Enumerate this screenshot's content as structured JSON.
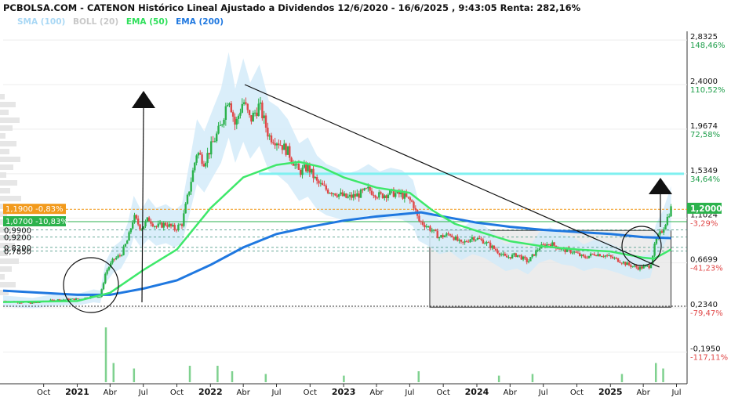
{
  "title": "PCBOLSA.COM - CATENON Histórico Lineal Ajustado a Dividendos 12/6/2020 - 16/6/2025 , 9:43:05 Renta: 282,16%",
  "legend": [
    {
      "label": "SMA (100)",
      "color": "#a9d8f5"
    },
    {
      "label": "BOLL (20)",
      "color": "#c8c8c8"
    },
    {
      "label": "EMA (50)",
      "color": "#2ee05a"
    },
    {
      "label": "EMA (200)",
      "color": "#1f78e0"
    }
  ],
  "colors": {
    "up": "#2bb24c",
    "down": "#e04848",
    "ema50": "#3ee86a",
    "ema200": "#1f78e0",
    "resistance": "#7ff0f0",
    "boll_fill": "#d4ebf9"
  },
  "chart_data": {
    "type": "candlestick",
    "x_ticks": [
      {
        "date": "2020-10-01",
        "label": "Oct",
        "bold": false
      },
      {
        "date": "2021-01-01",
        "label": "2021",
        "bold": true
      },
      {
        "date": "2021-04-01",
        "label": "Abr",
        "bold": false
      },
      {
        "date": "2021-07-01",
        "label": "Jul",
        "bold": false
      },
      {
        "date": "2021-10-01",
        "label": "Oct",
        "bold": false
      },
      {
        "date": "2022-01-01",
        "label": "2022",
        "bold": true
      },
      {
        "date": "2022-04-01",
        "label": "Abr",
        "bold": false
      },
      {
        "date": "2022-07-01",
        "label": "Jul",
        "bold": false
      },
      {
        "date": "2022-10-01",
        "label": "Oct",
        "bold": false
      },
      {
        "date": "2023-01-01",
        "label": "2023",
        "bold": true
      },
      {
        "date": "2023-04-01",
        "label": "Abr",
        "bold": false
      },
      {
        "date": "2023-07-01",
        "label": "Jul",
        "bold": false
      },
      {
        "date": "2023-10-01",
        "label": "Oct",
        "bold": false
      },
      {
        "date": "2024-01-01",
        "label": "2024",
        "bold": true
      },
      {
        "date": "2024-04-01",
        "label": "Abr",
        "bold": false
      },
      {
        "date": "2024-07-01",
        "label": "Jul",
        "bold": false
      },
      {
        "date": "2024-10-01",
        "label": "Oct",
        "bold": false
      },
      {
        "date": "2025-01-01",
        "label": "2025",
        "bold": true
      },
      {
        "date": "2025-04-01",
        "label": "Abr",
        "bold": false
      },
      {
        "date": "2025-07-01",
        "label": "Jul",
        "bold": false
      }
    ],
    "y_ticks": [
      {
        "value": 2.8325,
        "price": "2,8325",
        "pct": "148,46%"
      },
      {
        "value": 2.4,
        "price": "2,4000",
        "pct": "110,52%"
      },
      {
        "value": 1.9674,
        "price": "1,9674",
        "pct": "72,58%"
      },
      {
        "value": 1.5349,
        "price": "1,5349",
        "pct": "34,64%"
      },
      {
        "value": 1.1024,
        "price": "1,1024",
        "pct": "-3,29%"
      },
      {
        "value": 0.6699,
        "price": "0,6699",
        "pct": "-41,23%"
      },
      {
        "value": 0.234,
        "price": "0,2340",
        "pct": "-79,47%"
      },
      {
        "value": -0.195,
        "price": "-0,1950",
        "pct": "-117,11%"
      }
    ],
    "current_price": "1,2000",
    "left_tags": [
      {
        "text": "1,1900 -0,83%",
        "value": 1.19,
        "bg": "#f29a1c",
        "color": "#ffffff"
      },
      {
        "text": "1,0700 -10,83%",
        "value": 1.07,
        "bg": "#2bb24c",
        "color": "#ffffff"
      }
    ],
    "levels": [
      {
        "label": "0,9900",
        "value": 0.99
      },
      {
        "label": "0,9200",
        "value": 0.92
      },
      {
        "label": "0,8200",
        "value": 0.82
      },
      {
        "label": "0,7850",
        "value": 0.785
      }
    ],
    "resistance_level": 1.5349,
    "support_level": 0.234,
    "trend_line": {
      "start": {
        "date": "2022-04-05",
        "price": 2.4
      },
      "end": {
        "date": "2025-05-15",
        "price": 0.63
      }
    },
    "consolidation_box": {
      "from": "2023-08-25",
      "to": "2025-06-16",
      "high": 0.985,
      "low": 0.24
    },
    "prices": [
      [
        "2020-06-12",
        0.3
      ],
      [
        "2020-09-01",
        0.28
      ],
      [
        "2020-11-01",
        0.31
      ],
      [
        "2021-01-10",
        0.32
      ],
      [
        "2021-02-15",
        0.35
      ],
      [
        "2021-03-05",
        0.34
      ],
      [
        "2021-03-20",
        0.58
      ],
      [
        "2021-04-10",
        0.7
      ],
      [
        "2021-05-01",
        0.75
      ],
      [
        "2021-05-20",
        0.9
      ],
      [
        "2021-06-05",
        1.12
      ],
      [
        "2021-06-25",
        1.0
      ],
      [
        "2021-07-15",
        1.1
      ],
      [
        "2021-08-05",
        1.02
      ],
      [
        "2021-09-01",
        1.05
      ],
      [
        "2021-09-25",
        1.0
      ],
      [
        "2021-10-15",
        1.05
      ],
      [
        "2021-11-05",
        1.4
      ],
      [
        "2021-11-25",
        1.75
      ],
      [
        "2021-12-15",
        1.65
      ],
      [
        "2022-01-10",
        1.85
      ],
      [
        "2022-01-30",
        2.0
      ],
      [
        "2022-02-20",
        2.3
      ],
      [
        "2022-03-10",
        2.0
      ],
      [
        "2022-04-01",
        2.25
      ],
      [
        "2022-04-20",
        2.05
      ],
      [
        "2022-05-15",
        2.2
      ],
      [
        "2022-06-10",
        1.9
      ],
      [
        "2022-07-05",
        1.85
      ],
      [
        "2022-08-01",
        1.75
      ],
      [
        "2022-09-01",
        1.55
      ],
      [
        "2022-09-25",
        1.6
      ],
      [
        "2022-10-20",
        1.45
      ],
      [
        "2022-11-15",
        1.38
      ],
      [
        "2022-12-10",
        1.35
      ],
      [
        "2023-01-10",
        1.3
      ],
      [
        "2023-02-10",
        1.33
      ],
      [
        "2023-03-10",
        1.38
      ],
      [
        "2023-04-10",
        1.32
      ],
      [
        "2023-05-10",
        1.35
      ],
      [
        "2023-06-10",
        1.33
      ],
      [
        "2023-07-10",
        1.25
      ],
      [
        "2023-07-25",
        1.08
      ],
      [
        "2023-08-20",
        1.02
      ],
      [
        "2023-09-20",
        0.92
      ],
      [
        "2023-10-20",
        0.95
      ],
      [
        "2023-11-20",
        0.85
      ],
      [
        "2023-12-20",
        0.92
      ],
      [
        "2024-01-20",
        0.88
      ],
      [
        "2024-02-20",
        0.8
      ],
      [
        "2024-03-20",
        0.72
      ],
      [
        "2024-04-20",
        0.75
      ],
      [
        "2024-05-20",
        0.68
      ],
      [
        "2024-06-20",
        0.82
      ],
      [
        "2024-07-20",
        0.86
      ],
      [
        "2024-08-20",
        0.8
      ],
      [
        "2024-09-20",
        0.78
      ],
      [
        "2024-10-20",
        0.72
      ],
      [
        "2024-11-20",
        0.76
      ],
      [
        "2024-12-20",
        0.74
      ],
      [
        "2025-01-20",
        0.7
      ],
      [
        "2025-02-20",
        0.65
      ],
      [
        "2025-03-20",
        0.62
      ],
      [
        "2025-04-20",
        0.64
      ],
      [
        "2025-05-05",
        0.88
      ],
      [
        "2025-05-25",
        1.0
      ],
      [
        "2025-06-16",
        1.2
      ]
    ],
    "ema50": [
      [
        "2020-06-12",
        0.29
      ],
      [
        "2021-01-01",
        0.3
      ],
      [
        "2021-04-01",
        0.38
      ],
      [
        "2021-07-01",
        0.6
      ],
      [
        "2021-10-01",
        0.8
      ],
      [
        "2022-01-01",
        1.2
      ],
      [
        "2022-04-01",
        1.5
      ],
      [
        "2022-07-01",
        1.62
      ],
      [
        "2022-09-01",
        1.65
      ],
      [
        "2022-11-01",
        1.6
      ],
      [
        "2023-01-01",
        1.5
      ],
      [
        "2023-04-01",
        1.4
      ],
      [
        "2023-07-01",
        1.35
      ],
      [
        "2023-09-01",
        1.18
      ],
      [
        "2023-11-01",
        1.05
      ],
      [
        "2024-01-01",
        0.98
      ],
      [
        "2024-04-01",
        0.88
      ],
      [
        "2024-07-01",
        0.83
      ],
      [
        "2024-10-01",
        0.8
      ],
      [
        "2025-01-01",
        0.78
      ],
      [
        "2025-04-01",
        0.72
      ],
      [
        "2025-05-01",
        0.71
      ],
      [
        "2025-06-16",
        0.8
      ]
    ],
    "ema200": [
      [
        "2020-06-12",
        0.4
      ],
      [
        "2021-01-01",
        0.36
      ],
      [
        "2021-04-01",
        0.36
      ],
      [
        "2021-07-01",
        0.42
      ],
      [
        "2021-10-01",
        0.5
      ],
      [
        "2022-01-01",
        0.65
      ],
      [
        "2022-04-01",
        0.82
      ],
      [
        "2022-07-01",
        0.95
      ],
      [
        "2022-10-01",
        1.02
      ],
      [
        "2023-01-01",
        1.08
      ],
      [
        "2023-04-01",
        1.12
      ],
      [
        "2023-07-01",
        1.15
      ],
      [
        "2023-08-01",
        1.16
      ],
      [
        "2023-10-01",
        1.12
      ],
      [
        "2024-01-01",
        1.06
      ],
      [
        "2024-04-01",
        1.02
      ],
      [
        "2024-07-01",
        0.99
      ],
      [
        "2024-10-01",
        0.97
      ],
      [
        "2025-01-01",
        0.95
      ],
      [
        "2025-04-01",
        0.92
      ],
      [
        "2025-06-16",
        0.91
      ]
    ],
    "volume": [
      [
        "2021-03-20",
        1.0
      ],
      [
        "2021-04-10",
        0.35
      ],
      [
        "2021-06-05",
        0.25
      ],
      [
        "2021-11-05",
        0.3
      ],
      [
        "2022-01-20",
        0.3
      ],
      [
        "2022-03-01",
        0.2
      ],
      [
        "2022-06-01",
        0.15
      ],
      [
        "2023-01-01",
        0.12
      ],
      [
        "2023-07-25",
        0.2
      ],
      [
        "2024-03-01",
        0.12
      ],
      [
        "2024-06-01",
        0.15
      ],
      [
        "2025-02-01",
        0.15
      ],
      [
        "2025-05-05",
        0.35
      ],
      [
        "2025-05-25",
        0.25
      ]
    ]
  }
}
